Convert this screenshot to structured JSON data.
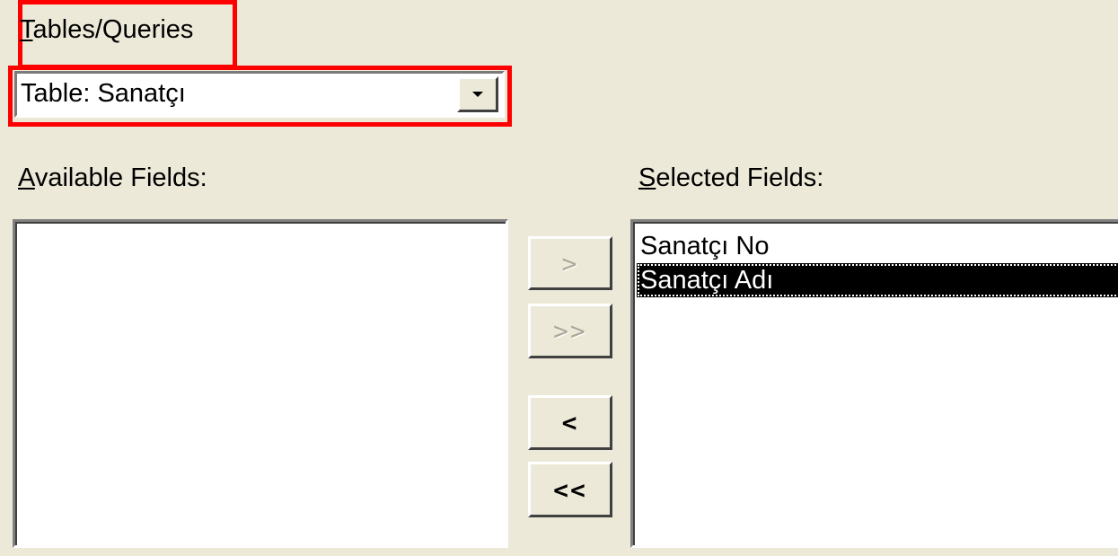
{
  "tables_queries": {
    "label_mnemonic": "T",
    "label_rest": "ables/Queries",
    "selected_value": "Table: Sanatçı"
  },
  "available_fields": {
    "label_mnemonic": "A",
    "label_rest": "vailable Fields:",
    "items": []
  },
  "selected_fields": {
    "label_mnemonic": "S",
    "label_rest": "elected Fields:",
    "items": [
      {
        "label": "Sanatçı No",
        "selected": false
      },
      {
        "label": "Sanatçı Adı",
        "selected": true
      }
    ]
  },
  "move_buttons": {
    "add_one": {
      "label": ">",
      "enabled": false
    },
    "add_all": {
      "label": ">>",
      "enabled": false
    },
    "remove_one": {
      "label": "<",
      "enabled": true
    },
    "remove_all": {
      "label": "<<",
      "enabled": true
    }
  },
  "highlight_color": "#FF0000",
  "selection_color": "#000000"
}
